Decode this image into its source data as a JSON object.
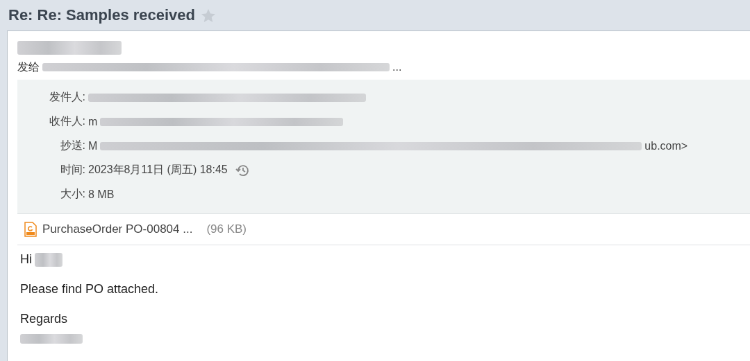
{
  "title": "Re: Re: Samples received",
  "starred": false,
  "recipients_line": {
    "label": "发给",
    "suffix": "..."
  },
  "headers": [
    {
      "label": "发件人:"
    },
    {
      "label": "收件人:",
      "prefix": "m"
    },
    {
      "label": "抄送:",
      "prefix": "M",
      "suffix": "ub.com>"
    },
    {
      "label": "时间:",
      "prefix": "2023年8月11日 (周五) 18:45",
      "kind": "time"
    },
    {
      "label": "大小:",
      "prefix": "8 MB",
      "kind": "plain"
    }
  ],
  "attachment": {
    "name": "PurchaseOrder PO-00804 ...",
    "size": "(96 KB)"
  },
  "body": [
    {
      "text": "Hi",
      "redacted": true
    },
    {
      "text": "Please find PO attached.",
      "redacted": false
    },
    {
      "text": "Regards",
      "redacted": false
    }
  ]
}
